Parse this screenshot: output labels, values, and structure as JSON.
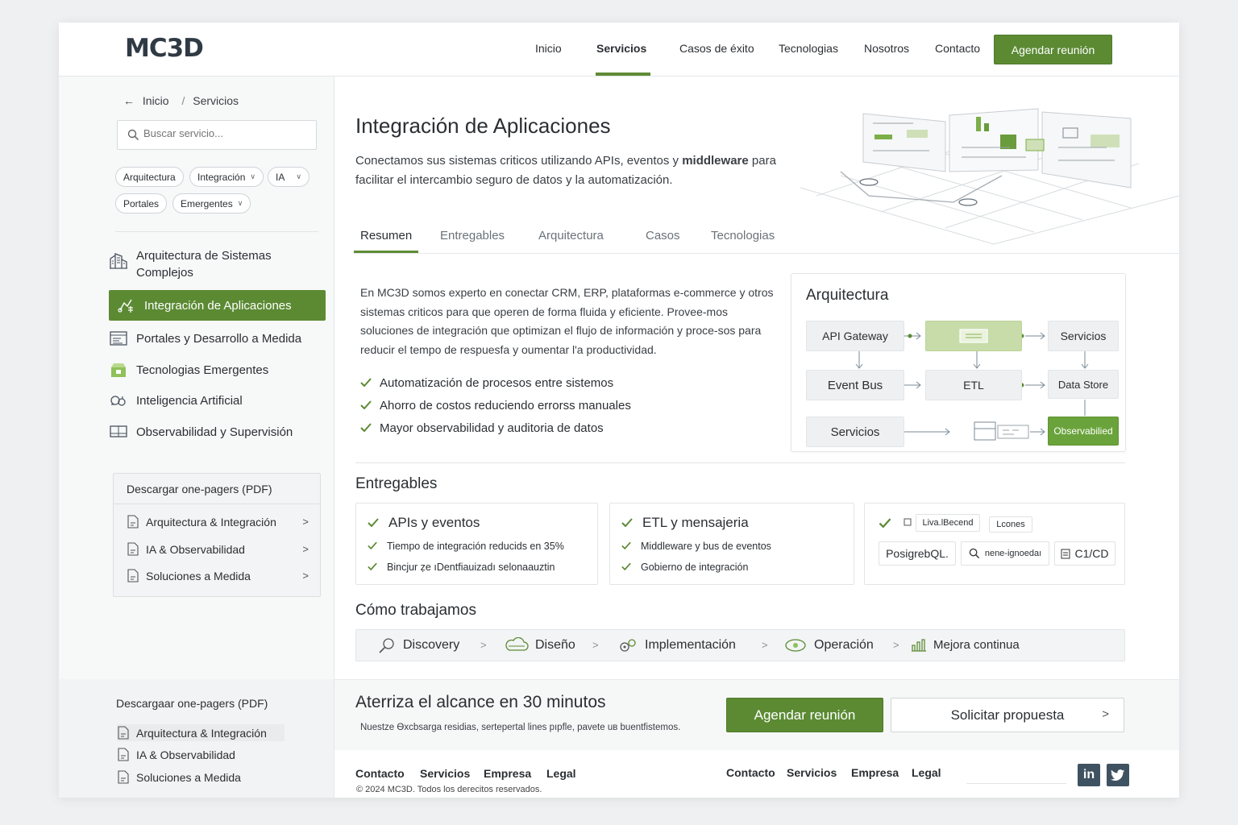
{
  "brand": {
    "logo": "MC3D",
    "accent": "#5b8a33"
  },
  "nav": {
    "items": [
      "Inicio",
      "Servicios",
      "Casos de éxito",
      "Tecnologias",
      "Nosotros",
      "Contacto"
    ],
    "active": "Servicios",
    "cta": "Agendar reunión"
  },
  "breadcrumb": {
    "home": "Inicio",
    "separator": "/",
    "current": "Servicios"
  },
  "search": {
    "placeholder": "Buscar servicio..."
  },
  "filters": [
    "Arquitectura",
    "Integración",
    "IA",
    "Portales",
    "Emergentes"
  ],
  "sidebar": {
    "items": [
      {
        "label": "Arquitectura de Sistemas Complejos",
        "icon": "building-icon"
      },
      {
        "label": "Integración de Aplicaciones",
        "icon": "integration-icon",
        "active": true
      },
      {
        "label": "Portales y Desarrollo a Medida",
        "icon": "portal-icon"
      },
      {
        "label": "Tecnologias Emergentes",
        "icon": "emerging-tech-icon"
      },
      {
        "label": "Inteligencia Artificial",
        "icon": "ai-icon"
      },
      {
        "label": "Observabilidad y Supervisión",
        "icon": "monitor-icon"
      }
    ],
    "downloads": {
      "title": "Descargar one-pagers (PDF)",
      "items": [
        "Arquitectura & Integración",
        "IA & Observabilidad",
        "Soluciones a Medida"
      ]
    },
    "downloads_bottom": {
      "title": "Descargaar one-pagers (PDF)",
      "items": [
        "Arquitectura & Integración",
        "IA & Observabilidad",
        "Soluciones a Medida"
      ]
    }
  },
  "page": {
    "title": "Integración de Aplicaciones",
    "lead_start": "Conectamos sus sistemas criticos utilizando APIs, eventos y",
    "lead_bold": "middleware",
    "lead_end": "para facilitar el intercambio seguro de datos y la automatización."
  },
  "tabs": [
    "Resumen",
    "Entregables",
    "Arquitectura",
    "Casos",
    "Tecnologias"
  ],
  "summary": {
    "paragraph": "En MC3D somos experto en conectar CRM, ERP, plataformas e-commerce y otros sistemas criticos para que operen de forma fluida y eficiente. Provee-mos soluciones de integración que optimizan el flujo de información y proce-sos para reducir el tempo de respuesfa y oumentar l'a productividad.",
    "benefits": [
      "Automatización de procesos entre sistemos",
      "Ahorro de costos reduciendo errorss manuales",
      "Mayor observabilidad y auditoria de datos"
    ]
  },
  "architecture": {
    "title": "Arquitectura",
    "nodes": {
      "api_gateway": "API Gateway",
      "servicios_top": "Servicios",
      "event_bus": "Event Bus",
      "etl": "ETL",
      "data_store": "Data Store",
      "servicios_bottom": "Servicios",
      "observabilidad": "Observabilied"
    }
  },
  "deliverables": {
    "title": "Entregables",
    "cards": [
      {
        "title": "APIs y eventos",
        "items": [
          "Tiempo de integración reducids en 35%",
          "Bincjur ẓe ıDentfiauizadı selonaauztin"
        ]
      },
      {
        "title": "ETL y mensajeria",
        "items": [
          "Middleware y bus de eventos",
          "Gobierno de integración"
        ]
      }
    ],
    "tags": [
      "Liva.lBecend",
      "Lcones",
      "PosigrebQL.",
      "nene-ignoedaı",
      "C1/CD"
    ]
  },
  "process": {
    "title": "Cómo trabajamos",
    "steps": [
      "Discovery",
      "Diseño",
      "Implementación",
      "Operación",
      "Mejora continua"
    ]
  },
  "cta": {
    "title": "Aterriza el alcance en 30 minutos",
    "subtitle": "Nuestze Ѳxcbsarga residias, sertepertal lines pıpfle, pavete uв buentfistemos.",
    "primary": "Agendar reunión",
    "secondary": "Solicitar propuesta"
  },
  "footer": {
    "links_left": [
      "Contacto",
      "Servicios",
      "Empresa",
      "Legal"
    ],
    "links_right": [
      "Contacto",
      "Servicios",
      "Empresa",
      "Legal"
    ],
    "copyright": "© 2024 MC3D. Todos los derecitos reservados.",
    "social": [
      "in",
      "twitter"
    ]
  }
}
